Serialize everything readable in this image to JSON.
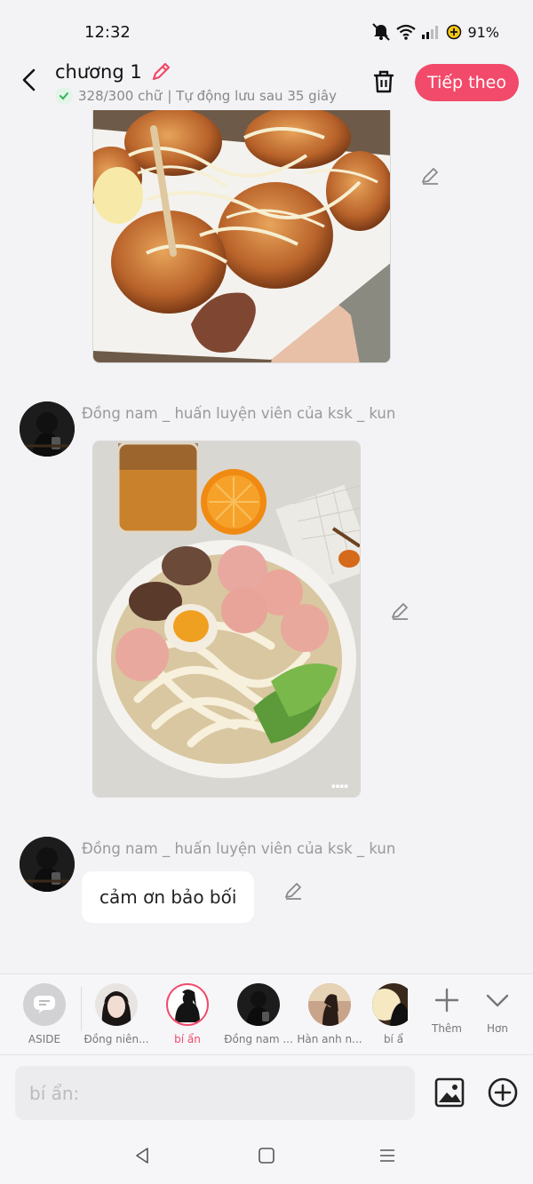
{
  "status_bar": {
    "time": "12:32",
    "battery": "91%"
  },
  "header": {
    "title": "chương 1",
    "word_count": "328/300 chữ",
    "autosave": "| Tự động lưu sau 35 giây",
    "next_label": "Tiếp theo"
  },
  "messages": [
    {
      "author": "Đồng nam _ huấn luyện viên của ksk _ kun"
    },
    {
      "author": "Đồng nam _ huấn luyện viên của ksk _ kun",
      "text": "cảm ơn bảo bối"
    }
  ],
  "characters": {
    "aside": "ASIDE",
    "items": [
      {
        "name": "Đồng niên..."
      },
      {
        "name": "bí ẩn",
        "selected": true
      },
      {
        "name": "Đồng nam ..."
      },
      {
        "name": "Hàn anh n..."
      },
      {
        "name": "bí ẩ"
      }
    ],
    "more_label": "Thêm",
    "collapse_label": "Hơn"
  },
  "input": {
    "placeholder": "bí ẩn:"
  },
  "colors": {
    "accent": "#f24a6a",
    "background": "#f3f3f5"
  }
}
